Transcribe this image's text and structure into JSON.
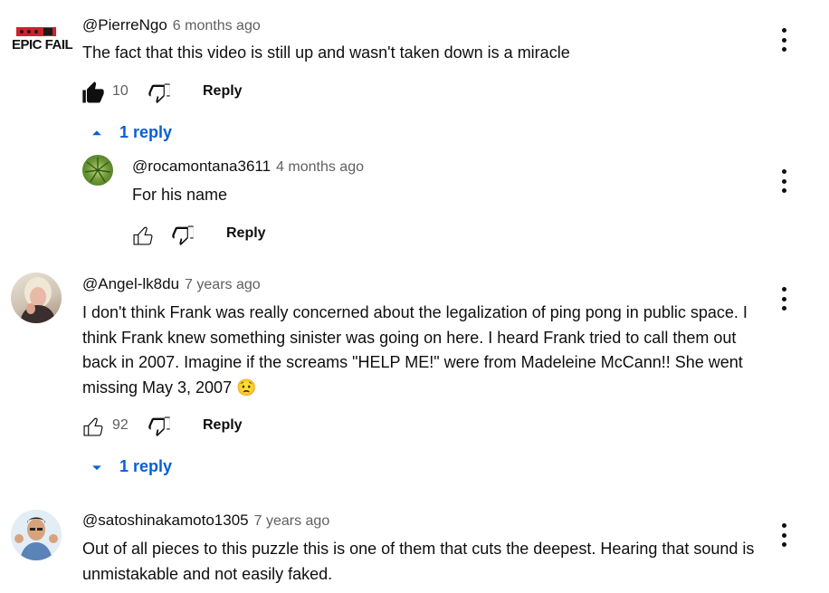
{
  "comments": [
    {
      "author": "@PierreNgo",
      "time": "6 months ago",
      "text": "The fact that this video is still up and wasn't taken down is a miracle",
      "likes": "10",
      "reply_label": "Reply",
      "replies_toggle": "1 reply",
      "avatar_text": "EPIC FAIL",
      "liked": true
    },
    {
      "author": "@rocamontana3611",
      "time": "4 months ago",
      "text": "For his name",
      "likes": "",
      "reply_label": "Reply"
    },
    {
      "author": "@Angel-lk8du",
      "time": "7 years ago",
      "text": "I don't think Frank was really concerned about the legalization of ping pong in public space. I think Frank knew something sinister was going on here. I heard Frank tried to call them out back in 2007. Imagine if the screams \"HELP ME!\" were from Madeleine McCann!! She went missing May 3, 2007 😟",
      "likes": "92",
      "reply_label": "Reply",
      "replies_toggle": "1 reply"
    },
    {
      "author": "@satoshinakamoto1305",
      "time": "7 years ago",
      "text": "Out of all pieces to this puzzle this is one of them that cuts the deepest. Hearing that sound is unmistakable and not easily faked."
    }
  ],
  "icons": {
    "like": "thumb-up-icon",
    "dislike": "thumb-down-icon",
    "more": "more-vert-icon",
    "expand_up": "chevron-up-icon",
    "expand_down": "chevron-down-icon"
  },
  "colors": {
    "link": "#065fd4",
    "meta": "#606060",
    "text": "#0f0f0f"
  }
}
